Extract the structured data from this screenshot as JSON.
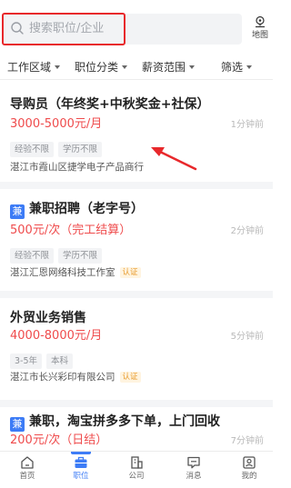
{
  "search": {
    "placeholder": "搜索职位/企业"
  },
  "map": {
    "label": "地图"
  },
  "filters": [
    {
      "label": "工作区域"
    },
    {
      "label": "职位分类"
    },
    {
      "label": "薪资范围"
    },
    {
      "label": "筛选"
    }
  ],
  "jobs": [
    {
      "type_tag": "",
      "title": "导购员（年终奖+中秋奖金+社保）",
      "salary": "3000-5000元/月",
      "time": "1分钟前",
      "tags": [
        "经验不限",
        "学历不限"
      ],
      "company": "湛江市霞山区捷学电子产品商行",
      "verified": ""
    },
    {
      "type_tag": "兼",
      "title": "兼职招聘（老字号）",
      "salary": "500元/次（完工结算）",
      "time": "2分钟前",
      "tags": [
        "经验不限",
        "学历不限"
      ],
      "company": "湛江汇恩网络科技工作室",
      "verified": "认证"
    },
    {
      "type_tag": "",
      "title": "外贸业务销售",
      "salary": "4000-8000元/月",
      "time": "5分钟前",
      "tags": [
        "3-5年",
        "本科"
      ],
      "company": "湛江市长兴彩印有限公司",
      "verified": "认证"
    },
    {
      "type_tag": "兼",
      "title": "兼职，淘宝拼多多下单，上门回收",
      "salary": "200元/次（日结）",
      "time": "7分钟前",
      "tags": [],
      "company": "",
      "verified": ""
    }
  ],
  "tabbar": [
    {
      "label": "首页",
      "icon": "home-icon"
    },
    {
      "label": "职位",
      "icon": "briefcase-icon",
      "active": true
    },
    {
      "label": "公司",
      "icon": "building-icon"
    },
    {
      "label": "消息",
      "icon": "message-icon"
    },
    {
      "label": "我的",
      "icon": "profile-icon"
    }
  ],
  "colors": {
    "accent": "#3d7cf6",
    "salary": "#ef4b4c",
    "highlight_box": "#e8282b",
    "verify_badge": "#e89a2b"
  }
}
